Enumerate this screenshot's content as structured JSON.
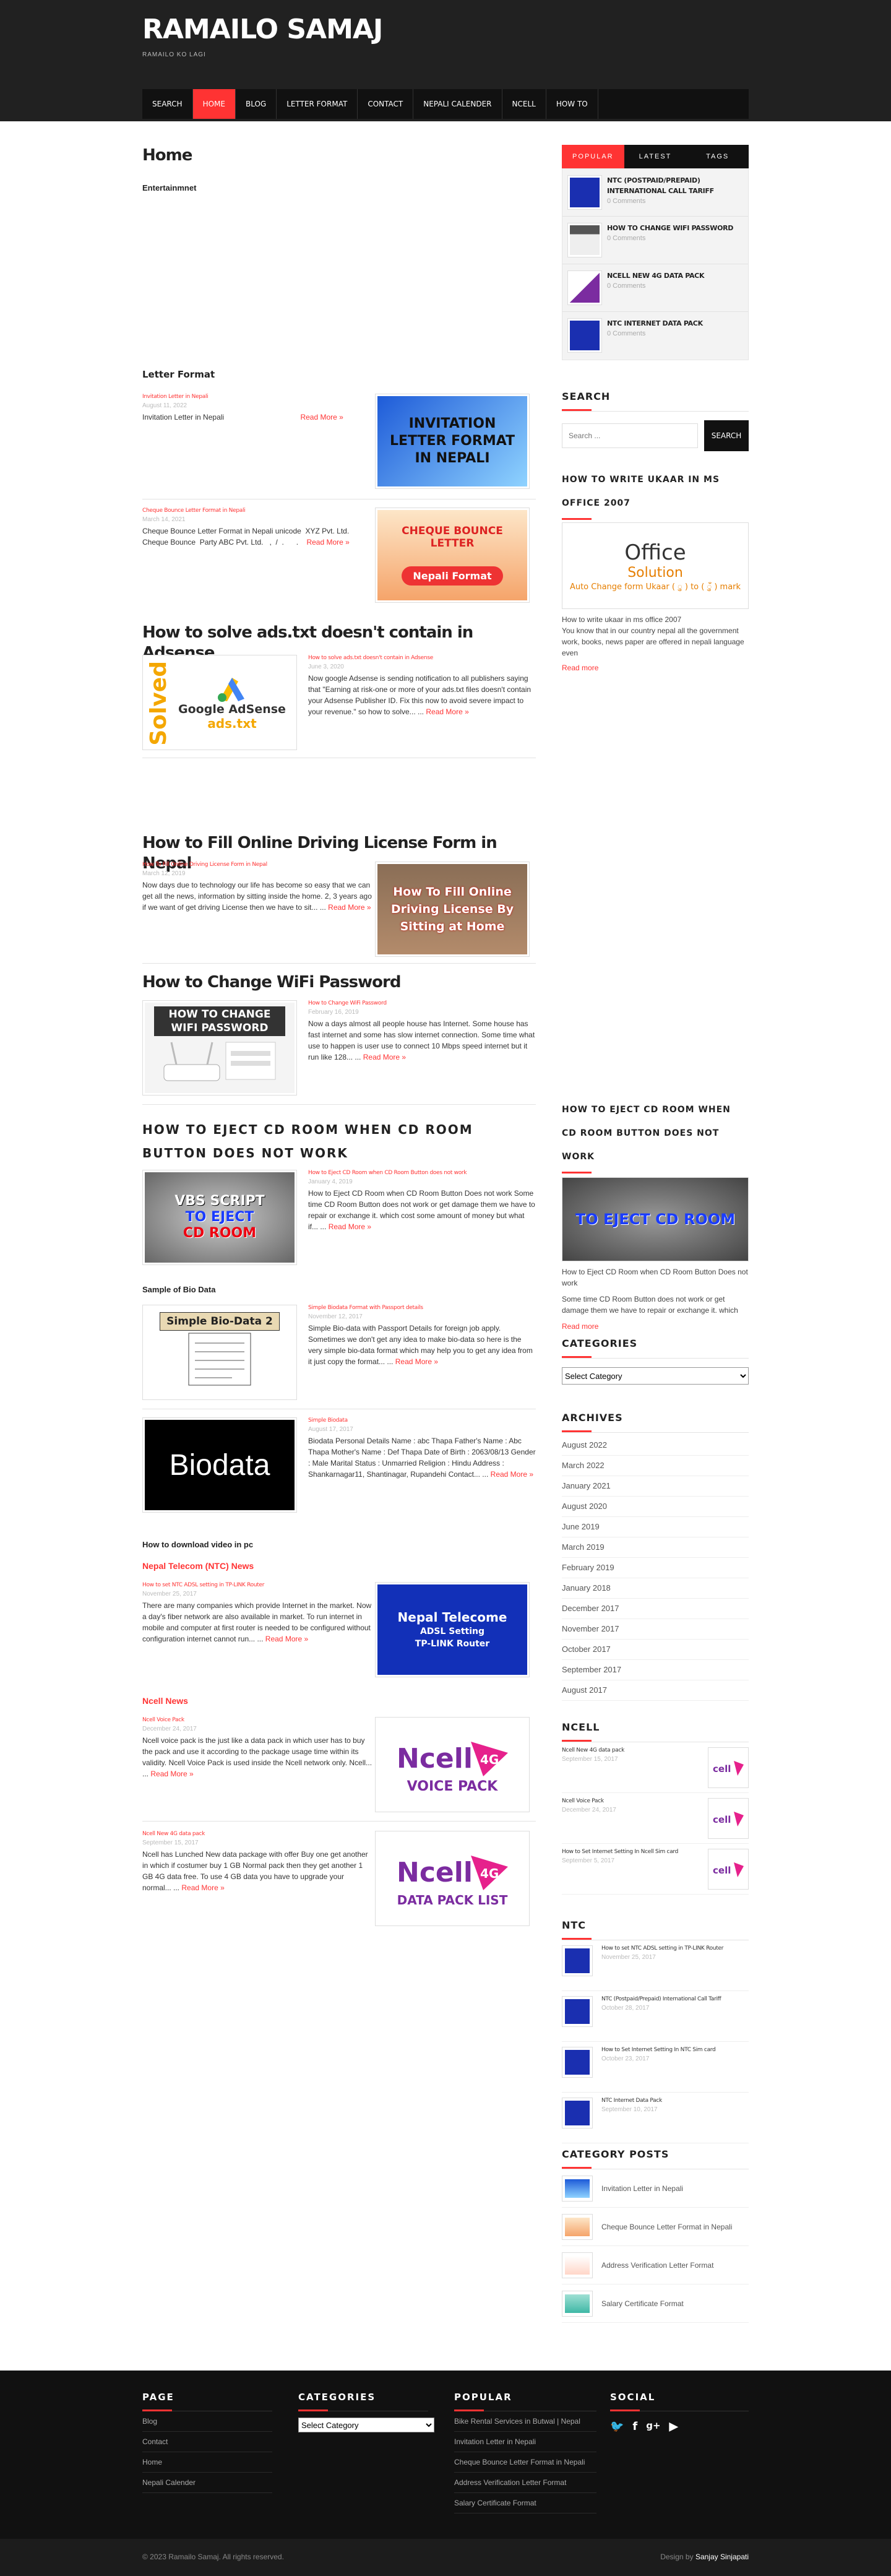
{
  "site": {
    "title": "RAMAILO SAMAJ",
    "tagline": "RAMAILO KO LAGI"
  },
  "nav": [
    "SEARCH",
    "HOME",
    "BLOG",
    "LETTER FORMAT",
    "CONTACT",
    "NEPALI CALENDER",
    "NCELL",
    "HOW TO"
  ],
  "main": {
    "page_title": "Home",
    "entertainment": "Entertainmnet",
    "letter_format": "Letter Format",
    "letter_posts": [
      {
        "title": "Invitation Letter in Nepali",
        "date": "August 11, 2022",
        "excerpt": "Invitation Letter in Nepali ‌‌‌‌‌‌‌‌‌‌‌‌ ‌‌‌‌‌‌‌ ‌‌‌‌‌‌ ‌‌‌‌ ‌‌‌‌‌‌ ‌‌‌‌ ‌ ‌‌‌ ‌ ‌‌‌‌ ‌‌ ‌‌‌‌‌ ‌‌‌‌‌‌‌‌‌‌‌‌‌‌‌‌‌‌‌‌‌‌‌‌‌‌‌‌‌‌‌‌‌‌‌‌‌‌‌‌‌ ‌‌‌ ‌‌‌‌‌‌ ‌‌‌‌ ‌‌‌‌‌‌ ‌‌‌‌‌‌‌‌ ‌‌‌‌‌ ‌‌‌‌‌ ‌‌‌‌ ‌‌‌‌ ‌‌‌ ‌‌ ‌‌‌‌ ‌‌‌‌ ‌‌‌ ‌‌‌‌‌‌‌ ‌‌‌‌‌‌‌ ‌‌‌‌ ‌‌‌‌‌‌ ‌‌‌‌ ‌‌‌ ‌‌‌‌‌ ‌‌‌‌ ‌",
        "thumb": "INVITATION LETTER FORMAT IN NEPALI"
      },
      {
        "title": "Cheque Bounce Letter Format in Nepali",
        "date": "March 14, 2021",
        "excerpt": "Cheque Bounce Letter Format in Nepali unicode ‌‌‌ XYZ Pvt. Ltd. ‌‌‌ ‌‌‌‌‌‌ ‌ Cheque Bounce ‌‌‌‌ Party ABC Pvt. Ltd. ‌‌ ‌‌ , ‌‌‌‌ ‌‌‌‌‌/‌‌‌‌ ‌‌‌‌ ‌‌. ‌‌ ‌‌‌‌‌‌‌ ‌‌‌‌‌‌ ‌‌‌‌‌ ‌‌ ‌‌. ‌‌‌‌‌ ‌‌ ‌‌‌‌‌‌‌‌‌‌‌‌‌‌‌‌‌‌‌‌‌‌‌‌‌",
        "thumb_top": "CHEQUE BOUNCE LETTER",
        "thumb_bottom": "Nepali Format"
      }
    ],
    "adsense": {
      "heading": "How to solve ads.txt doesn't contain in Adsense",
      "title": "How to solve ads.txt doesn't contain in Adsense",
      "date": "June 3, 2020",
      "excerpt": "Now google Adsense is sending notification to all publishers saying that \"Earning at risk-one or more of your ads.txt files doesn't contain your Adsense Publisher ID. Fix this now to avoid severe impact to your revenue.\" so how to solve... ...",
      "thumb_side": "Solved",
      "thumb_a": "Google AdSense",
      "thumb_b": "ads.txt"
    },
    "driving": {
      "heading": "How to Fill Online Driving License Form in Nepal",
      "title": "How To Fill Online Driving License Form in Nepal",
      "date": "March 12, 2019",
      "excerpt": "Now days due to technology our life has become so easy that we can get all the news, information by sitting inside the home. 2, 3 years ago if we want of get driving License then we have to sit... ...",
      "thumb": "How To Fill Online Driving License By Sitting at Home"
    },
    "wifi": {
      "heading": "How to Change WiFi Password",
      "title": "How to Change WiFi Password",
      "date": "February 16, 2019",
      "excerpt": "Now a days almost all people house has Internet. Some house has fast internet and some has slow internet connection. Some time what use to happen is user use to connect 10 Mbps speed internet but it run like 128... ...",
      "thumb": "HOW TO CHANGE WIFI PASSWORD"
    },
    "cdroom": {
      "heading": "HOW TO EJECT CD ROOM WHEN CD ROOM BUTTON DOES NOT WORK",
      "title": "How to Eject CD Room when CD Room Button does not work",
      "date": "January 4, 2019",
      "excerpt": "How to Eject CD Room when CD Room Button Does not work Some time CD Room Button does not work or get damage them we have to repair or exchange it. which cost some amount of money but what if... ...",
      "thumb_a": "VBS SCRIPT",
      "thumb_b": "TO EJECT",
      "thumb_c": "CD ROOM"
    },
    "biodata_h": "Sample of Bio Data",
    "bio_posts": [
      {
        "title": "Simple Biodata Format with Passport details",
        "date": "November 12, 2017",
        "excerpt": "Simple Bio-data with Passport Details for foreign job apply. Sometimes we don't get any idea to make bio-data so here is the very simple bio-data format which may help you to get any idea from it just copy the format... ...",
        "thumb": "Simple Bio-Data 2"
      },
      {
        "title": "Simple Biodata",
        "date": "August 17, 2017",
        "excerpt": "Biodata Personal Details Name : abc Thapa Father's Name : Abc Thapa Mother's Name : Def Thapa Date of Birth : 2063/08/13 Gender : Male Marital Status : Unmarried Religion : Hindu Address : Shankarnagar11, Shantinagar, Rupandehi Contact... ...",
        "thumb": "Biodata"
      }
    ],
    "download_h": "How to download video in pc",
    "ntc_h": "Nepal Telecom (NTC) News",
    "ntc_post": {
      "title": "How to set NTC ADSL setting in TP-LINK Router",
      "date": "November 25, 2017",
      "excerpt": "There are many companies which provide Internet in the market. Now a day's fiber network are also available in market. To run internet in mobile and computer at first router is needed to be configured without configuration internet cannot run... ...",
      "thumb_a": "Nepal Telecome",
      "thumb_b": "ADSL Setting",
      "thumb_c": "TP-LINK Router"
    },
    "ncell_h": "Ncell News",
    "ncell_posts": [
      {
        "title": "Ncell Voice Pack",
        "date": "December 24, 2017",
        "excerpt": "Ncell voice pack is the just like a data pack in which user has to buy the pack and use it according to the package usage time within its validity. Ncell Voice Pack is used inside the Ncell network only. Ncell... ...",
        "thumb": "VOICE PACK"
      },
      {
        "title": "Ncell New 4G data pack",
        "date": "September 15, 2017",
        "excerpt": "Ncell has Lunched New data package with offer Buy one get another in which if costumer buy 1 GB Normal pack then they get another 1 GB 4G data free. To use 4 GB data you have to upgrade your normal... ...",
        "thumb": "DATA PACK LIST"
      }
    ],
    "read_more": "Read More »"
  },
  "sidebar": {
    "tabs": [
      "POPULAR",
      "LATEST",
      "TAGS"
    ],
    "popular": [
      {
        "title": "NTC (POSTPAID/PREPAID) INTERNATIONAL CALL TARIFF",
        "comments": "0 Comments"
      },
      {
        "title": "HOW TO CHANGE WIFI PASSWORD",
        "comments": "0 Comments"
      },
      {
        "title": "NCELL NEW 4G DATA PACK",
        "comments": "0 Comments"
      },
      {
        "title": "NTC INTERNET DATA PACK",
        "comments": "0 Comments"
      }
    ],
    "search_h": "SEARCH",
    "search_placeholder": "Search ...",
    "search_btn": "SEARCH",
    "ukaar": {
      "heading": "HOW TO WRITE UKAAR IN MS OFFICE 2007",
      "img_a": "Office",
      "img_b": "Solution",
      "img_c": "Auto Change form Ukaar ( ु ) to ( ुँ ) mark",
      "text1": "How to write ukaar in ms office 2007",
      "text2": "You know that in our country nepal all the government work, books, news paper are offered in nepali language even",
      "more": "Read more"
    },
    "cdroom": {
      "heading": "HOW TO EJECT CD ROOM WHEN CD ROOM BUTTON DOES NOT WORK",
      "img": "TO EJECT CD ROOM",
      "text1": "How to Eject CD Room when CD Room Button Does not work",
      "text2": "Some time CD Room Button does not work or get damage them we have to repair or exchange it. which",
      "more": "Read more"
    },
    "categories_h": "CATEGORIES",
    "categories_select": "Select Category",
    "archives_h": "ARCHIVES",
    "archives": [
      "August 2022",
      "March 2022",
      "January 2021",
      "August 2020",
      "June 2019",
      "March 2019",
      "February 2019",
      "January 2018",
      "December 2017",
      "November 2017",
      "October 2017",
      "September 2017",
      "August 2017"
    ],
    "ncell_h": "NCELL",
    "ncell_posts": [
      {
        "title": "Ncell New 4G data pack",
        "date": "September 15, 2017"
      },
      {
        "title": "Ncell Voice Pack",
        "date": "December 24, 2017"
      },
      {
        "title": "How to Set Internet Setting In Ncell Sim card",
        "date": "September 5, 2017"
      }
    ],
    "ntc_h": "NTC",
    "ntc_posts": [
      {
        "title": "How to set NTC ADSL setting in TP-LINK Router",
        "date": "November 25, 2017"
      },
      {
        "title": "NTC (Postpaid/Prepaid) International Call Tariff",
        "date": "October 28, 2017"
      },
      {
        "title": "How to Set Internet Setting In NTC Sim card",
        "date": "October 23, 2017"
      },
      {
        "title": "NTC Internet Data Pack",
        "date": "September 10, 2017"
      }
    ],
    "catposts_h": "CATEGORY POSTS",
    "catposts": [
      "Invitation Letter in Nepali",
      "Cheque Bounce Letter Format in Nepali",
      "Address Verification Letter Format",
      "Salary Certificate Format"
    ]
  },
  "footer": {
    "page_h": "PAGE",
    "pages": [
      "Blog",
      "Contact",
      "Home",
      "Nepali Calender"
    ],
    "categories_h": "CATEGORIES",
    "categories_select": "Select Category",
    "popular_h": "POPULAR",
    "popular": [
      "Bike Rental Services in Butwal | Nepal",
      "Invitation Letter in Nepali",
      "Cheque Bounce Letter Format in Nepali",
      "Address Verification Letter Format",
      "Salary Certificate Format"
    ],
    "social_h": "SOCIAL",
    "copyright": "© 2023 Ramailo Samaj. All rights reserved.",
    "design_by": "Design by",
    "designer": "Sanjay Sinjapati"
  },
  "colors": {
    "accent": "#ff3333",
    "header": "#212121",
    "footer": "#111111"
  }
}
